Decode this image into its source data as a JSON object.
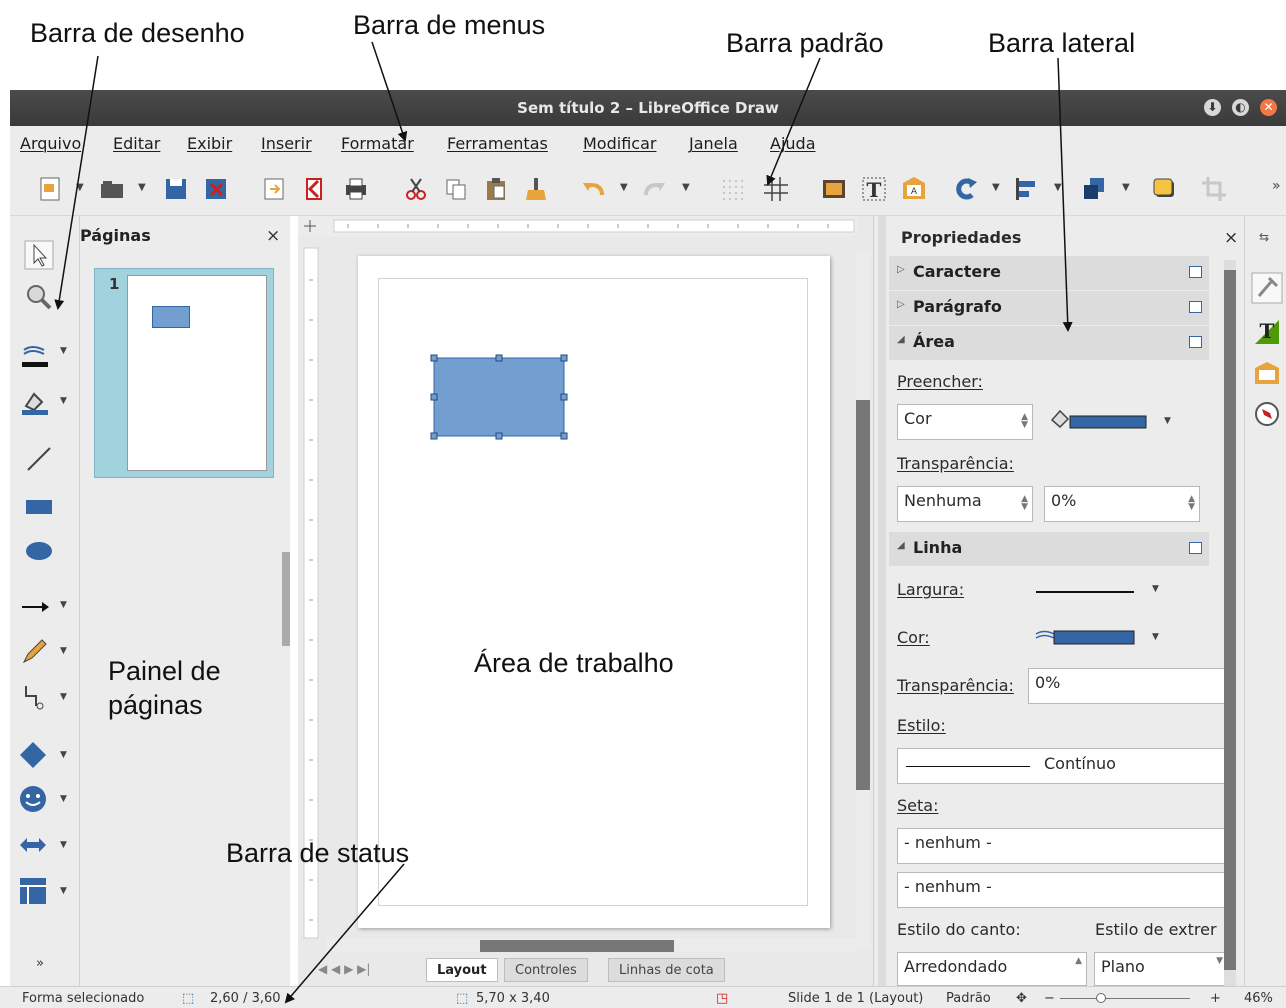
{
  "annotations": {
    "drawing_bar": "Barra de desenho",
    "menu_bar": "Barra de menus",
    "standard_bar": "Barra padrão",
    "sidebar": "Barra lateral",
    "pages_panel": "Painel de\npáginas",
    "work_area": "Área de trabalho",
    "status_bar": "Barra de status"
  },
  "window": {
    "title": "Sem título 2 – LibreOffice Draw"
  },
  "menu": {
    "items": [
      "Arquivo",
      "Editar",
      "Exibir",
      "Inserir",
      "Formatar",
      "Ferramentas",
      "Modificar",
      "Janela",
      "Ajuda"
    ]
  },
  "pages_panel": {
    "title": "Páginas",
    "close": "×",
    "thumb_number": "1"
  },
  "sidebar": {
    "title": "Propriedades",
    "close": "×",
    "sections": {
      "character": "Caractere",
      "paragraph": "Parágrafo",
      "area": "Área",
      "line": "Linha"
    },
    "area": {
      "fill_label": "Preencher:",
      "fill_value": "Cor",
      "transparency_label": "Transparência:",
      "transparency_value": "Nenhuma",
      "transparency_pct": "0%"
    },
    "line": {
      "width_label": "Largura:",
      "color_label": "Cor:",
      "transparency_label": "Transparência:",
      "transparency_value": "0%",
      "style_label": "Estilo:",
      "style_value": "Contínuo",
      "arrow_label": "Seta:",
      "arrow_start": "- nenhum -",
      "arrow_end": "- nenhum -",
      "corner_label": "Estilo do canto:",
      "cap_label": "Estilo de extrer",
      "corner_value": "Arredondado",
      "cap_value": "Plano"
    }
  },
  "tabs": [
    "Layout",
    "Controles",
    "Linhas de cota"
  ],
  "status": {
    "selection": "Forma selecionado",
    "position": "2,60 / 3,60",
    "size": "5,70 x 3,40",
    "slide": "Slide 1 de 1 (Layout)",
    "layout": "Padrão",
    "zoom": "46%"
  },
  "colors": {
    "shape_fill": "#729fcf",
    "shape_border": "#3465a4",
    "page_thumb_bg": "#a3d2df"
  }
}
